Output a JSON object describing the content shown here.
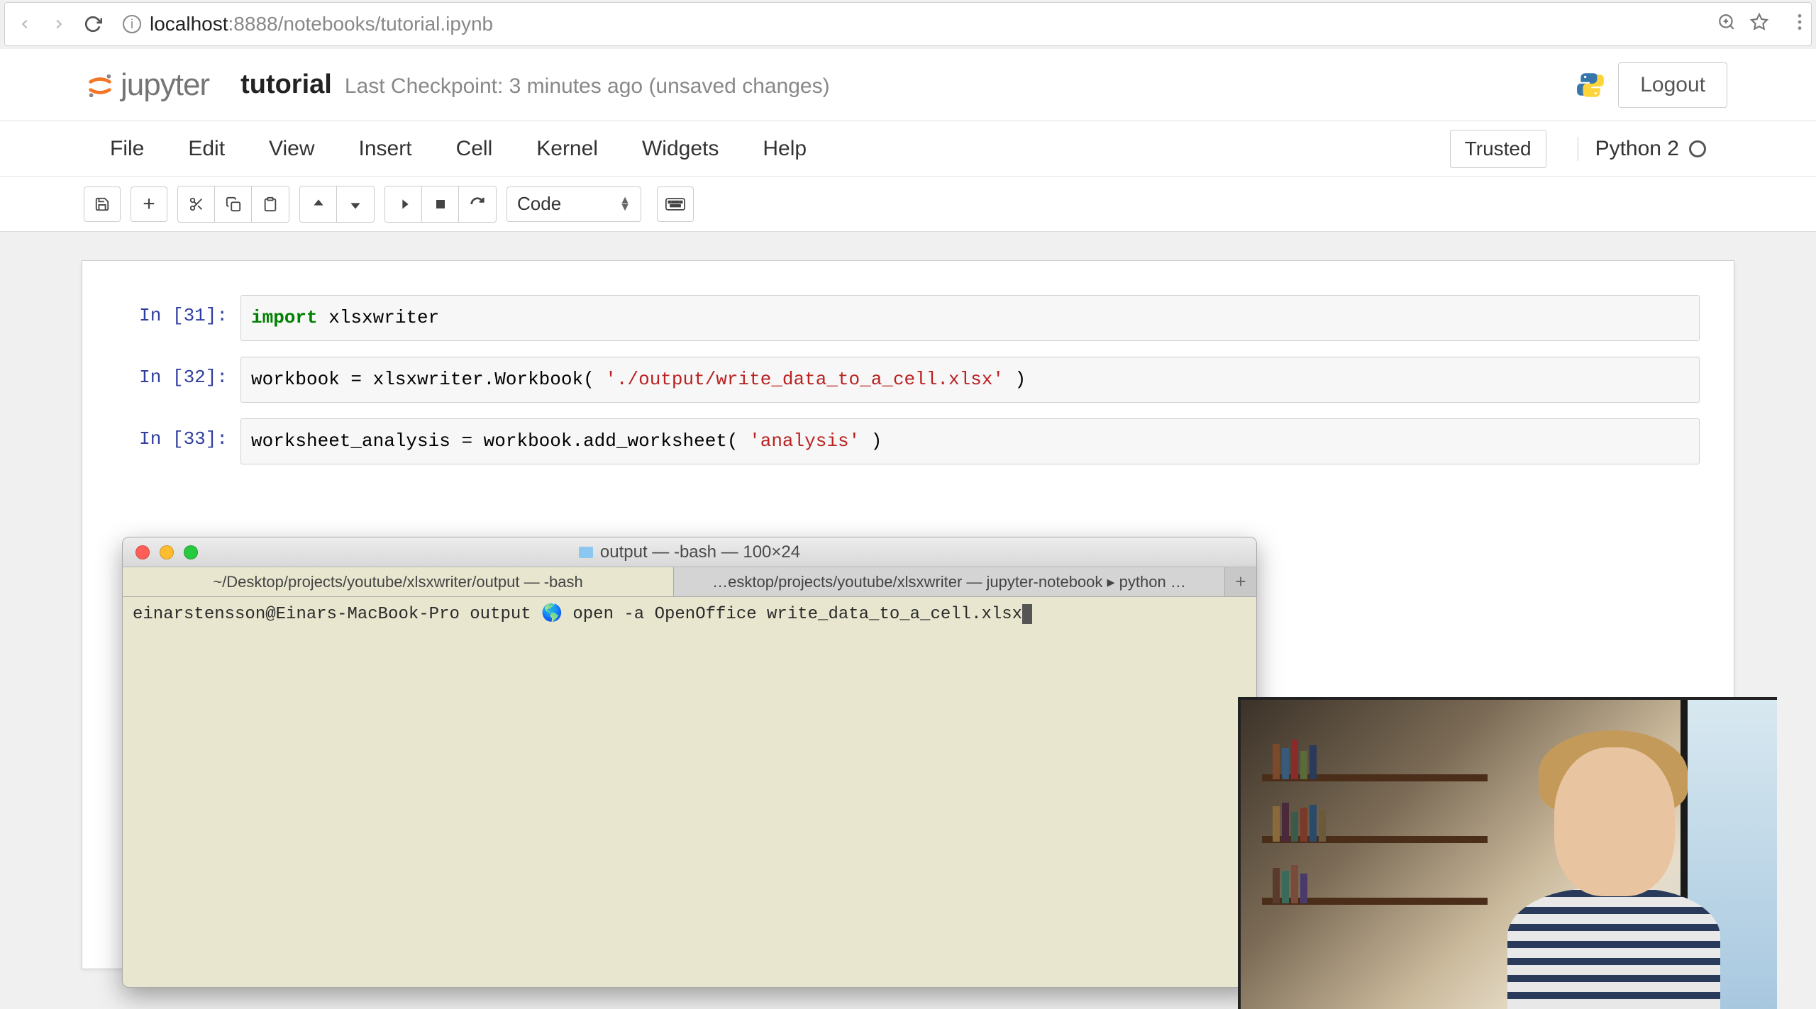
{
  "browser": {
    "url_host": "localhost",
    "url_port": ":8888",
    "url_path": "/notebooks/tutorial.ipynb"
  },
  "header": {
    "logo_text": "jupyter",
    "notebook_title": "tutorial",
    "checkpoint": "Last Checkpoint: 3 minutes ago (unsaved changes)",
    "logout": "Logout"
  },
  "menu": {
    "items": [
      "File",
      "Edit",
      "View",
      "Insert",
      "Cell",
      "Kernel",
      "Widgets",
      "Help"
    ],
    "trusted": "Trusted",
    "kernel": "Python 2"
  },
  "toolbar": {
    "celltype": "Code"
  },
  "cells": [
    {
      "prompt": "In [31]:",
      "code": {
        "prefix": "import",
        "rest": " xlsxwriter"
      }
    },
    {
      "prompt": "In [32]:",
      "code": {
        "plain1": "workbook = xlsxwriter.Workbook( ",
        "str": "'./output/write_data_to_a_cell.xlsx'",
        "plain2": " )"
      }
    },
    {
      "prompt": "In [33]:",
      "code": {
        "plain1": "worksheet_analysis = workbook.add_worksheet( ",
        "str": "'analysis'",
        "plain2": " )"
      }
    }
  ],
  "terminal": {
    "title": "output — -bash — 100×24",
    "tabs": [
      "~/Desktop/projects/youtube/xlsxwriter/output — -bash",
      "…esktop/projects/youtube/xlsxwriter — jupyter-notebook ▸ python  …"
    ],
    "prompt": "einarstensson@Einars-MacBook-Pro output 🌎 open -a OpenOffice write_data_to_a_cell.xlsx"
  }
}
